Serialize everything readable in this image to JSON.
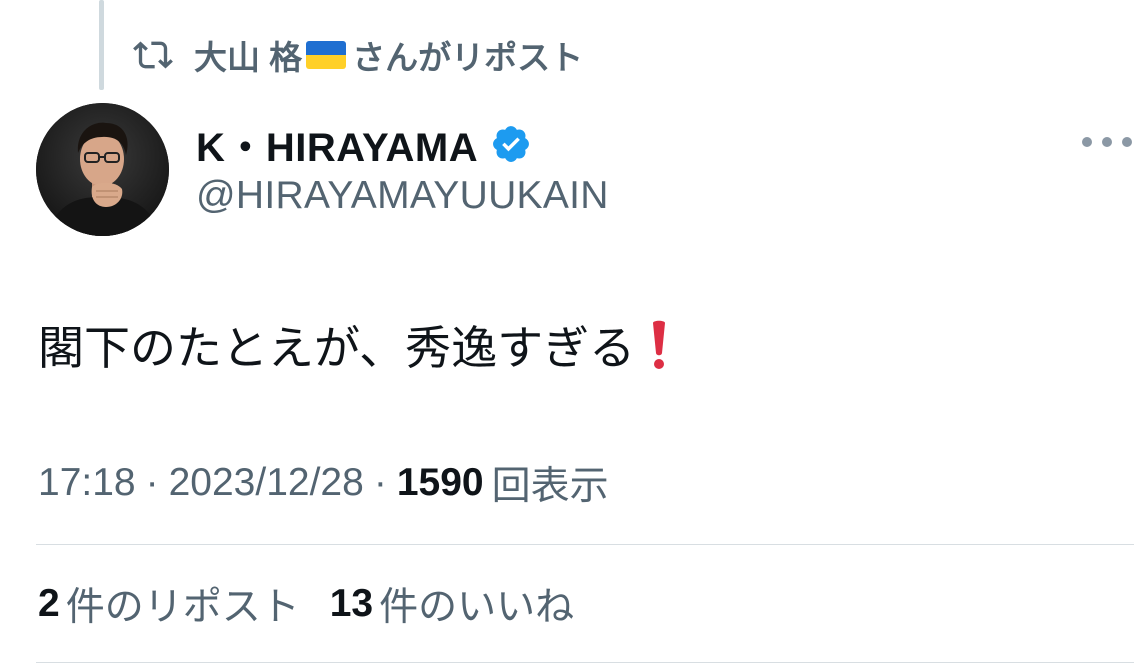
{
  "repost_context": {
    "name": "大山 格",
    "suffix": "さんがリポスト"
  },
  "author": {
    "display_name": "K・HIRAYAMA",
    "handle": "@HIRAYAMAYUUKAIN"
  },
  "post": {
    "text": "閣下のたとえが、秀逸すぎる"
  },
  "meta": {
    "time": "17:18",
    "separator": "·",
    "date": "2023/12/28",
    "views_count": "1590",
    "views_label": "回表示"
  },
  "stats": {
    "reposts_count": "2",
    "reposts_label": "件のリポスト",
    "likes_count": "13",
    "likes_label": "件のいいね"
  },
  "colors": {
    "text_primary": "#0f1419",
    "text_secondary": "#536471",
    "verified_blue": "#1d9bf0",
    "exclamation_red": "#dd2e44",
    "divider": "#d8dee2"
  },
  "icons": {
    "repost": "repost-icon",
    "flag": "ukraine-flag-icon",
    "verified": "verified-badge-icon",
    "more": "more-options-icon",
    "exclamation": "red-exclamation-icon"
  }
}
